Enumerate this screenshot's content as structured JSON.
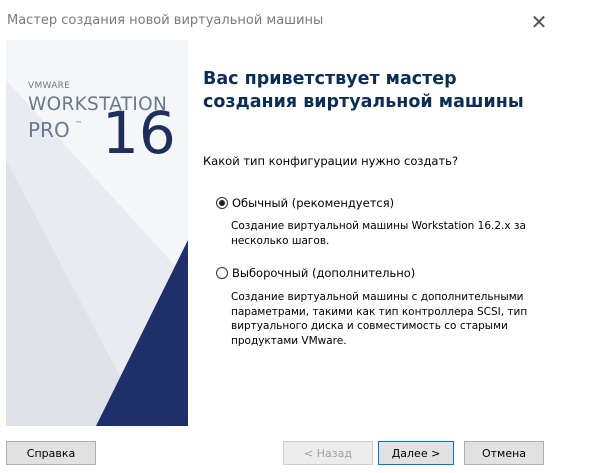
{
  "window": {
    "title": "Мастер создания новой виртуальной машины",
    "close_glyph": "✕"
  },
  "brand": {
    "vendor": "VMWARE",
    "product": "WORKSTATION",
    "edition": "PRO",
    "trademark": "™",
    "version": "16"
  },
  "main": {
    "heading": "Вас приветствует мастер создания виртуальной машины",
    "question": "Какой тип конфигурации нужно создать?",
    "options": [
      {
        "label": "Обычный (рекомендуется)",
        "selected": true,
        "description": "Создание виртуальной машины Workstation 16.2.x за несколько шагов."
      },
      {
        "label": "Выборочный (дополнительно)",
        "selected": false,
        "description": "Создание виртуальной машины с дополнительными параметрами, такими как тип контроллера SCSI, тип виртуального диска и совместимость со старыми продуктами VMware."
      }
    ]
  },
  "buttons": {
    "help": "Справка",
    "back": "< Назад",
    "next": "Далее >",
    "cancel": "Отмена"
  },
  "colors": {
    "heading": "#0c2d55",
    "accent_triangle": "#1f2f6a",
    "panel_background": "#f4f6f8"
  }
}
